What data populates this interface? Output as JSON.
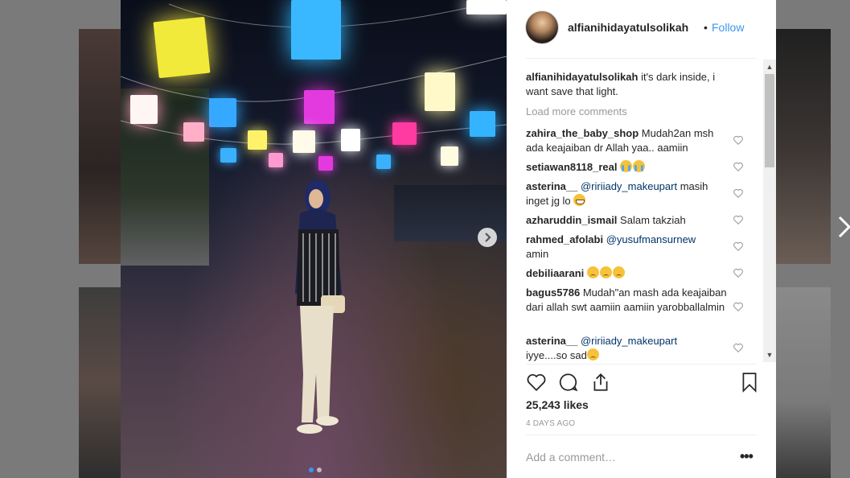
{
  "post": {
    "username": "alfianihidayatulsolikah",
    "separator": "•",
    "follow_label": "Follow",
    "caption": "it's dark inside, i want save that light.",
    "load_more_label": "Load more comments",
    "likes": "25,243 likes",
    "time": "4 DAYS AGO",
    "add_comment_placeholder": "Add a comment…",
    "more_label": "•••",
    "carousel_pages": 2,
    "carousel_active": 1
  },
  "comments": [
    {
      "user": "zahira_the_baby_shop",
      "text": "Mudah2an msh ada keajaiban dr Allah yaa.. aamiin"
    },
    {
      "user": "setiawan8118_real",
      "text": "",
      "emojis": [
        "cry",
        "cry"
      ]
    },
    {
      "user": "asterina__",
      "mention": "@ririiady_makeupart",
      "text": "masih inget jg lo",
      "emojis": [
        "grin"
      ]
    },
    {
      "user": "azharuddin_ismail",
      "text": "Salam takziah"
    },
    {
      "user": "rahmed_afolabi",
      "mention": "@yusufmansurnew",
      "text": "amin"
    },
    {
      "user": "debiliaarani",
      "text": "",
      "emojis": [
        "sad",
        "sad",
        "sad"
      ]
    },
    {
      "user": "bagus5786",
      "text": "Mudah\"an mash ada keajaiban dari allah swt aamiin aamiin yarobballalmin"
    },
    {
      "user": "asterina__",
      "mention": "@ririiady_makeupart",
      "text": "iyye....so sad",
      "emojis": [
        "sad"
      ]
    }
  ],
  "icons": [
    "heart-icon",
    "comment-icon",
    "share-icon",
    "bookmark-icon",
    "chevron-right-icon"
  ],
  "colors": {
    "link": "#3897f0",
    "mention": "#003569",
    "muted": "#999999",
    "text": "#262626"
  }
}
